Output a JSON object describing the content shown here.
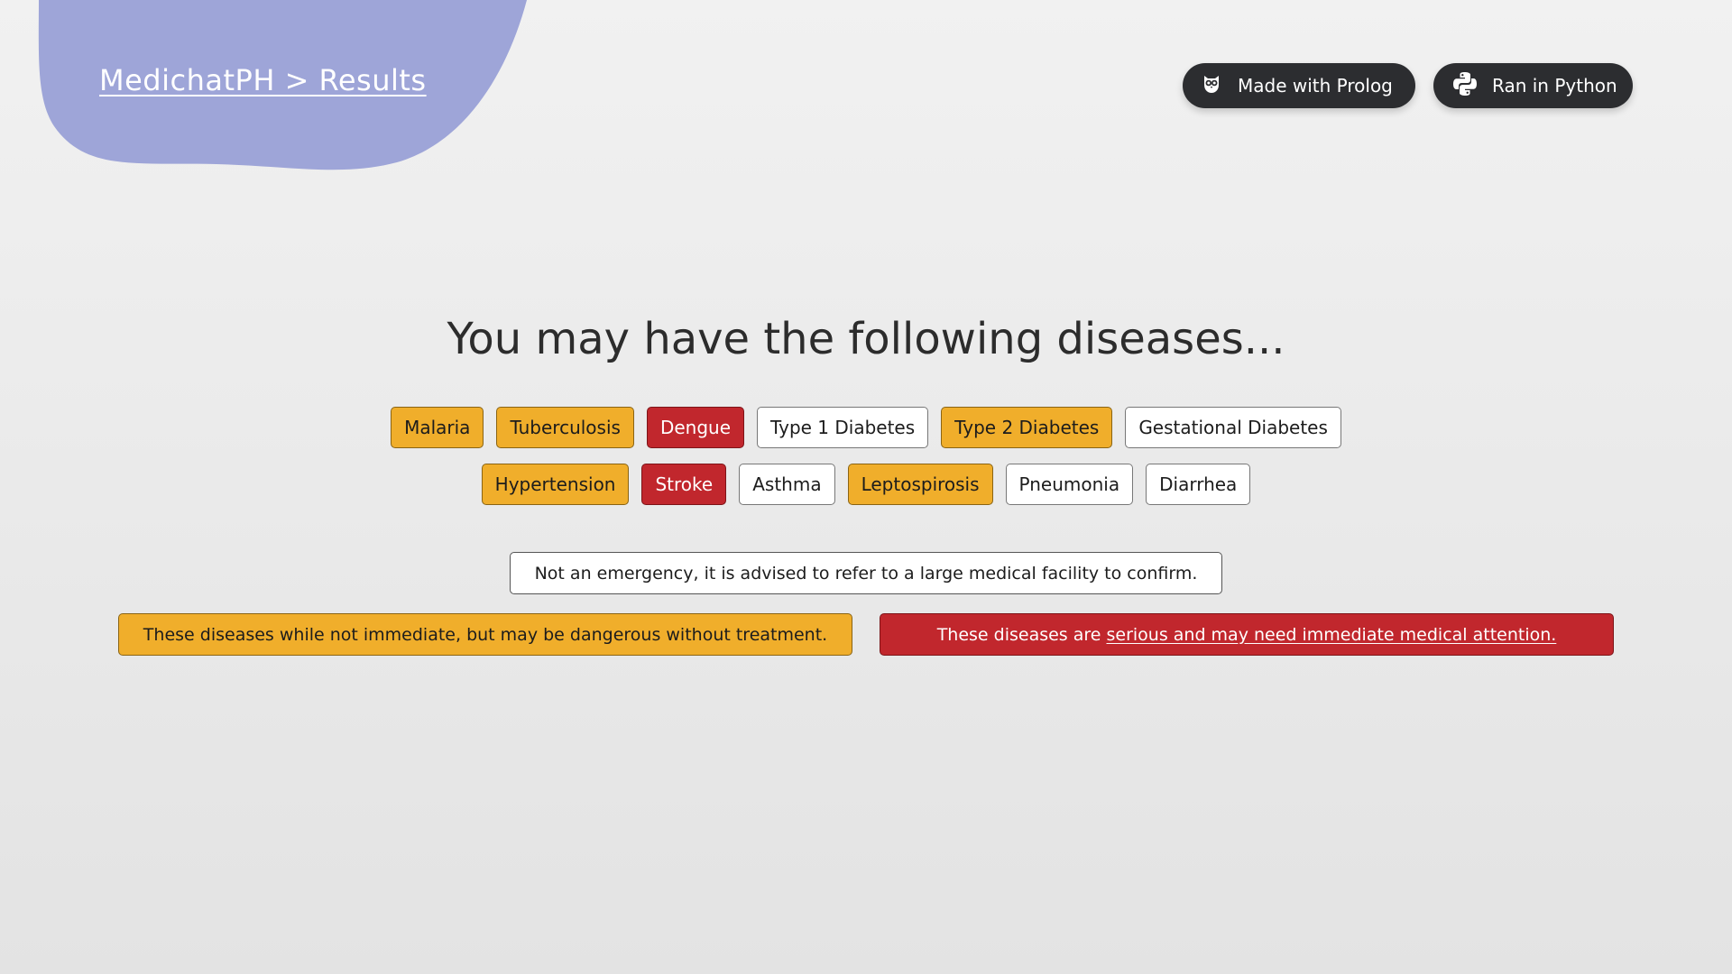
{
  "header": {
    "breadcrumb": "MedichatPH > Results",
    "blob_color": "#9ea5d8",
    "badges": [
      {
        "label": "Made with Prolog",
        "icon": "owl-icon"
      },
      {
        "label": "Ran in Python",
        "icon": "python-icon"
      }
    ]
  },
  "main": {
    "heading": "You may have the following diseases...",
    "diseases_row1": [
      {
        "name": "Malaria",
        "severity": "moderate"
      },
      {
        "name": "Tuberculosis",
        "severity": "moderate"
      },
      {
        "name": "Dengue",
        "severity": "serious"
      },
      {
        "name": "Type 1 Diabetes",
        "severity": "mild"
      },
      {
        "name": "Type 2 Diabetes",
        "severity": "moderate"
      },
      {
        "name": "Gestational Diabetes",
        "severity": "mild"
      }
    ],
    "diseases_row2": [
      {
        "name": "Hypertension",
        "severity": "moderate"
      },
      {
        "name": "Stroke",
        "severity": "serious"
      },
      {
        "name": "Asthma",
        "severity": "mild"
      },
      {
        "name": "Leptospirosis",
        "severity": "moderate"
      },
      {
        "name": "Pneumonia",
        "severity": "mild"
      },
      {
        "name": "Diarrhea",
        "severity": "mild"
      }
    ]
  },
  "legend": {
    "mild": "Not an emergency, it is advised to refer to a large medical facility to confirm.",
    "moderate": "These diseases while not immediate, but may be dangerous without treatment.",
    "serious_prefix": "These diseases are",
    "serious_link": "serious and may need immediate medical attention."
  },
  "colors": {
    "moderate": "#f0ae2b",
    "serious": "#c1272d",
    "mild": "#ffffff",
    "badge_bg": "#2c2d30"
  }
}
